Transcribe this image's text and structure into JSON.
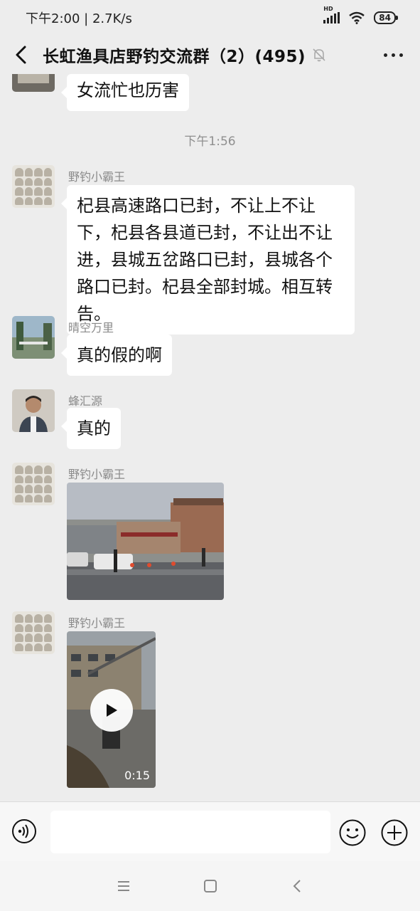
{
  "status": {
    "time": "下午2:00",
    "speed": "2.7K/s",
    "network": "HD",
    "battery": "84"
  },
  "header": {
    "title": "长虹渔具店野钓交流群（2）(495)",
    "icons": [
      "back-arrow-icon",
      "mute-bell-icon",
      "more-dots-icon"
    ]
  },
  "messages": [
    {
      "type": "text",
      "sender": "",
      "text": "女流忙也历害"
    },
    {
      "type": "time",
      "text": "下午1:56"
    },
    {
      "type": "text",
      "sender": "野钓小霸王",
      "text": "杞县高速路口已封，不让上不让下，杞县各县道已封，不让出不让进，县城五岔路口已封，县城各个路口已封。杞县全部封城。相互转告。"
    },
    {
      "type": "text",
      "sender": "晴空万里",
      "text": "真的假的啊"
    },
    {
      "type": "text",
      "sender": "蜂汇源",
      "text": "真的"
    },
    {
      "type": "image",
      "sender": "野钓小霸王"
    },
    {
      "type": "video",
      "sender": "野钓小霸王",
      "duration": "0:15"
    }
  ],
  "input": {
    "icons": [
      "voice-icon",
      "emoji-icon",
      "plus-icon"
    ]
  },
  "navigation": {
    "icons": [
      "menu-icon",
      "home-square-icon",
      "back-chevron-icon"
    ]
  },
  "colors": {
    "background": "#ededed",
    "bubble": "#ffffff",
    "secondary_text": "#8a8a8a"
  }
}
